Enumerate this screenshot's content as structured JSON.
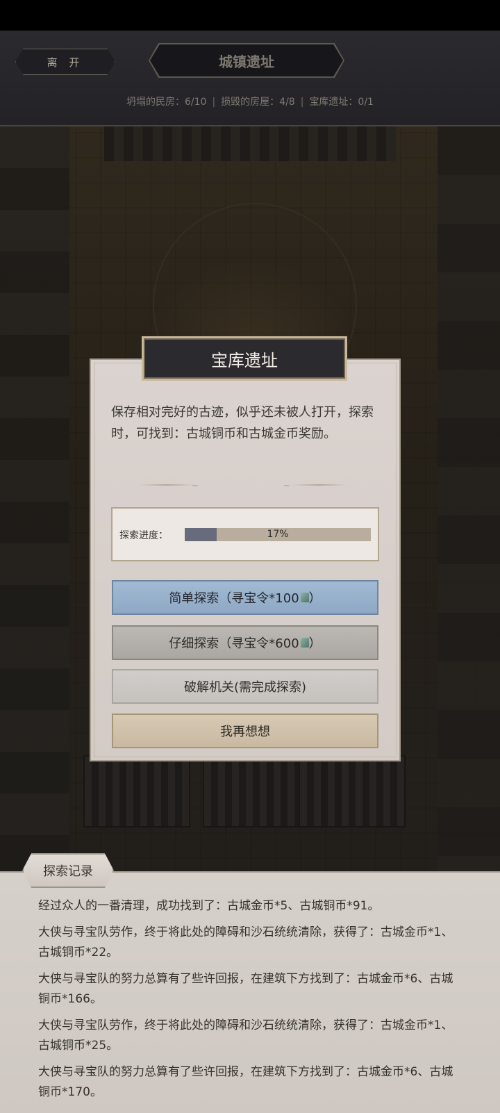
{
  "header": {
    "leave_label": "离 开",
    "title": "城镇遗址",
    "stats": {
      "collapsed_houses": "坍塌的民房：6/10",
      "damaged_buildings": "损毁的房屋：4/8",
      "vault_ruins": "宝库遗址：0/1"
    }
  },
  "dialog": {
    "title": "宝库遗址",
    "description": "保存相对完好的古迹，似乎还未被人打开，探索时，可找到：古城铜币和古城金币奖励。",
    "progress": {
      "label": "探索进度：",
      "value_text": "17%",
      "fraction": 0.17
    },
    "buttons": {
      "simple_search": "简单探索（寻宝令*100",
      "simple_search_end": "）",
      "detailed_search": "仔细探索（寻宝令*600",
      "detailed_search_end": "）",
      "crack_mechanism": "破解机关(需完成探索)",
      "think_again": "我再想想"
    },
    "token_icon": "jade-token-icon"
  },
  "log": {
    "tab_label": "探索记录",
    "entries": [
      "经过众人的一番清理，成功找到了：古城金币*5、古城铜币*91。",
      "大侠与寻宝队劳作，终于将此处的障碍和沙石统统清除，获得了：古城金币*1、古城铜币*22。",
      "大侠与寻宝队的努力总算有了些许回报，在建筑下方找到了：古城金币*6、古城铜币*166。",
      "大侠与寻宝队劳作，终于将此处的障碍和沙石统统清除，获得了：古城金币*1、古城铜币*25。",
      "大侠与寻宝队的努力总算有了些许回报，在建筑下方找到了：古城金币*6、古城铜币*170。"
    ]
  },
  "colors": {
    "primary_button": "#8ea8c4",
    "progress_fill": "#686b7c",
    "dialog_bg": "#d8d1cc",
    "title_plate": "#2b2a2f"
  }
}
